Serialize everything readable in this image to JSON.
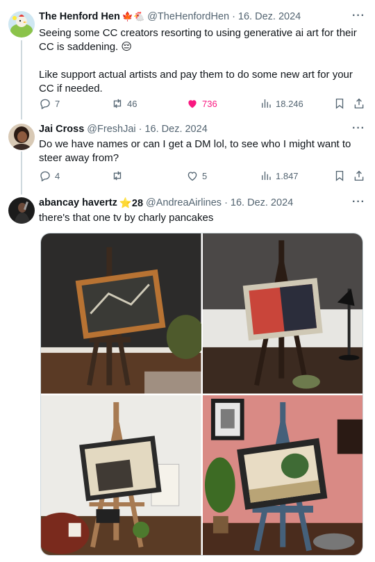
{
  "tweets": [
    {
      "name": "The Henford Hen",
      "badges": "🍁🐔",
      "handle": "@TheHenfordHen",
      "date": "16. Dez. 2024",
      "text_line1": "Seeing some CC creators resorting to using generative ai art for their CC is saddening. 😔",
      "text_line2": "Like support actual artists and pay them to do some new art for your CC if needed.",
      "replies": "7",
      "retweets": "46",
      "likes": "736",
      "views": "18.246"
    },
    {
      "name": "Jai Cross",
      "handle": "@FreshJai",
      "date": "16. Dez. 2024",
      "text": "Do we have names or can I get a DM lol, to see who I might want to steer away from?",
      "replies": "4",
      "retweets": "",
      "likes": "5",
      "views": "1.847"
    },
    {
      "name": "abancay havertz",
      "badges": "⭐28",
      "handle": "@AndreaAirlines",
      "date": "16. Dez. 2024",
      "text": "there's that one tv by charly pancakes"
    }
  ],
  "ui": {
    "more_label": "···",
    "dot": "·"
  },
  "colors": {
    "like_active": "#f91880",
    "muted": "#536471",
    "text": "#0f1419"
  }
}
